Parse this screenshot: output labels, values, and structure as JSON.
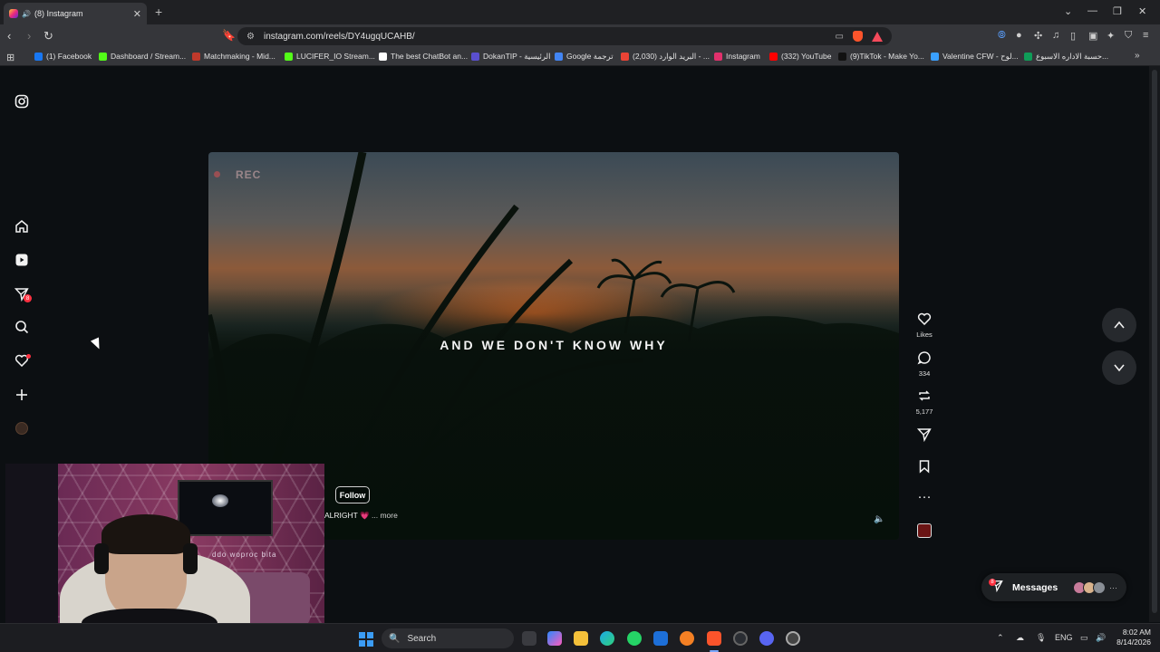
{
  "browser": {
    "tab_title": "(8) Instagram",
    "new_tab_icon": "plus-icon",
    "url": "instagram.com/reels/DY4ugqUCAHB/",
    "bookmarks": [
      {
        "label": "(1) Facebook",
        "color": "#1877f2"
      },
      {
        "label": "Dashboard / Stream...",
        "color": "#53fc18"
      },
      {
        "label": "Matchmaking - Mid...",
        "color": "#c0392b"
      },
      {
        "label": "LUCIFER_IO Stream...",
        "color": "#53fc18"
      },
      {
        "label": "The best ChatBot an...",
        "color": "#ffffff"
      },
      {
        "label": "DokanTIP - الرئيسية",
        "color": "#5a4fcf"
      },
      {
        "label": "Google ترجمة",
        "color": "#4285f4"
      },
      {
        "label": "(2,030) البريد الوارد - ...",
        "color": "#ea4335"
      },
      {
        "label": "Instagram",
        "color": "#e1306c"
      },
      {
        "label": "(332) YouTube",
        "color": "#ff0000"
      },
      {
        "label": "(9)TikTok - Make Yo...",
        "color": "#111111"
      },
      {
        "label": "Valentine CFW - لوح...",
        "color": "#3aa0ff"
      },
      {
        "label": "حسبة الاداره الاسبوع...",
        "color": "#0f9d58"
      }
    ]
  },
  "sidebar": {
    "notifications_badge": "8"
  },
  "reel": {
    "overlay_rec": "REC",
    "caption_text": "AND WE DON'T KNOW WHY",
    "follow_label": "Follow",
    "description": "ALRIGHT 💗",
    "more_label": "... more",
    "actions": {
      "likes_label": "Likes",
      "comments_count": "334",
      "reposts_count": "5,177"
    }
  },
  "messages": {
    "label": "Messages",
    "badge": "8"
  },
  "webcam": {
    "wall_text": "ddo woproc bita"
  },
  "taskbar": {
    "search_placeholder": "Search",
    "language": "ENG",
    "time": "8:02 AM",
    "date": "8/14/2026"
  },
  "colors": {
    "accent_red": "#ff3040",
    "page_bg": "#0c0f12"
  }
}
